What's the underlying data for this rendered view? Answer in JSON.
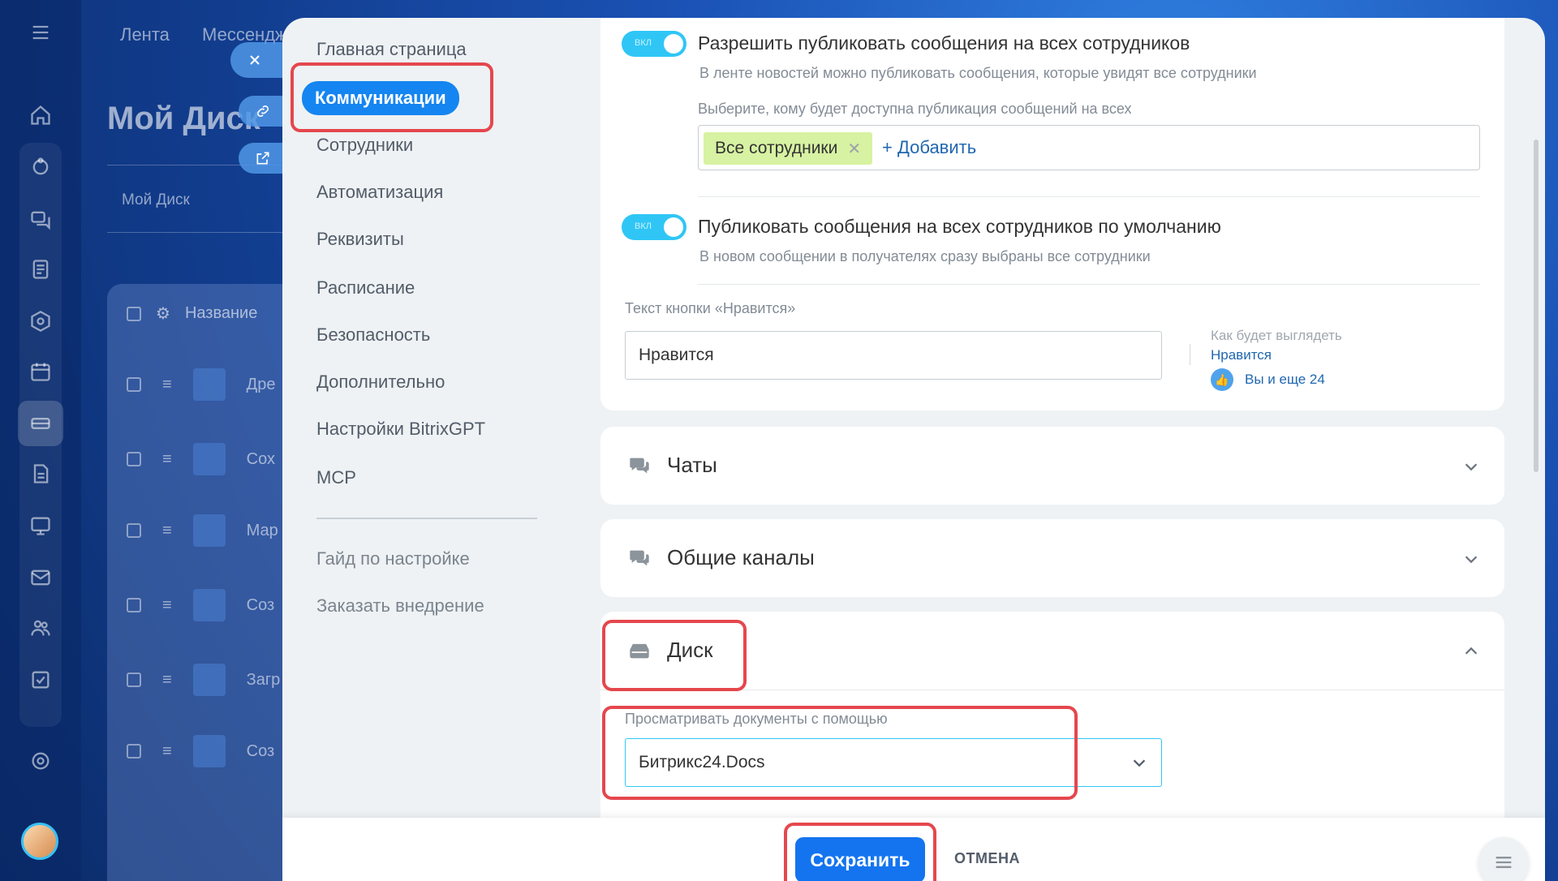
{
  "background": {
    "topnav": [
      "Лента",
      "Мессендж"
    ],
    "disk_title": "Мой Диск",
    "breadcrumb": "Мой Диск",
    "table_header": "Название",
    "rows": [
      "Дре",
      "Сох",
      "Мар",
      "Соз",
      "Загр",
      "Соз"
    ]
  },
  "menu": {
    "items": [
      "Главная страница",
      "Коммуникации",
      "Сотрудники",
      "Автоматизация",
      "Реквизиты",
      "Расписание",
      "Безопасность",
      "Дополнительно",
      "Настройки BitrixGPT",
      "MCP"
    ],
    "links": [
      "Гайд по настройке",
      "Заказать внедрение"
    ]
  },
  "feed": {
    "toggle_label": "ВКЛ",
    "allow_all_title": "Разрешить публиковать сообщения на всех сотрудников",
    "allow_all_hint": "В ленте новостей можно публиковать сообщения, которые увидят все сотрудники",
    "who_label": "Выберите, кому будет доступна публикация сообщений на всех",
    "tag": "Все сотрудники",
    "add_link": "+ Добавить",
    "default_title": "Публиковать сообщения на всех сотрудников по умолчанию",
    "default_hint": "В новом сообщении в получателях сразу выбраны все сотрудники",
    "like_label": "Текст кнопки «Нравится»",
    "like_value": "Нравится",
    "preview_title": "Как будет выглядеть",
    "preview_like": "Нравится",
    "preview_who": "Вы и еще 24"
  },
  "sections": {
    "chats": "Чаты",
    "channels": "Общие каналы",
    "disk": "Диск"
  },
  "disk": {
    "viewer_label": "Просматривать документы с помощью",
    "viewer_value": "Битрикс24.Docs"
  },
  "footer": {
    "save": "Сохранить",
    "cancel": "ОТМЕНА"
  },
  "colors": {
    "accent": "#1474ef",
    "toggle": "#2fc6f6",
    "highlight": "#e5474e",
    "tag": "#d7f2a2"
  }
}
